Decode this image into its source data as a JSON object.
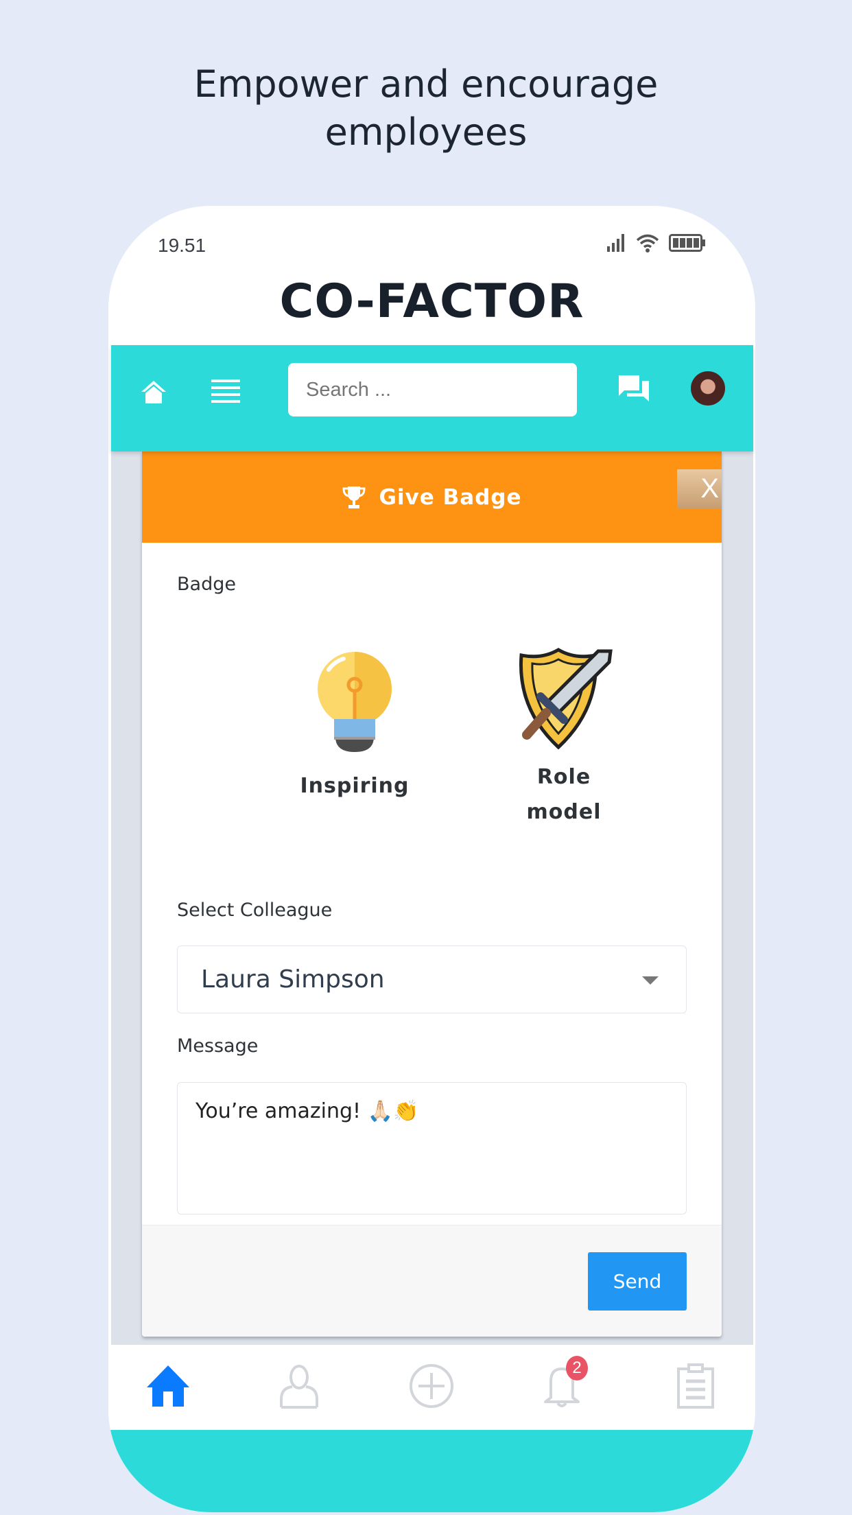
{
  "headline": {
    "line1": "Empower and encourage",
    "line2": "employees"
  },
  "status_bar": {
    "time": "19.51",
    "icons": [
      "signal-icon",
      "wifi-icon",
      "battery-icon"
    ]
  },
  "app": {
    "brand": "CO-FACTOR",
    "accent": "#2cdada",
    "header_color": "#fd9213",
    "primary": "#2196f3"
  },
  "topbar": {
    "search_placeholder": "Search ...",
    "icons": [
      "home-icon",
      "menu-icon",
      "chat-icon",
      "avatar"
    ]
  },
  "modal": {
    "title": "Give Badge",
    "close": "X",
    "badge_label": "Badge",
    "badges": [
      {
        "name": "Inspiring",
        "icon": "lightbulb-icon"
      },
      {
        "name": "Role\nmodel",
        "line1": "Role",
        "line2": "model",
        "icon": "shield-sword-icon"
      }
    ],
    "colleague_label": "Select Colleague",
    "colleague_value": "Laura Simpson",
    "message_label": "Message",
    "message_value": "You’re amazing! 🙏🏻👏",
    "send": "Send"
  },
  "bottom_nav": {
    "items": [
      "home",
      "profile",
      "add",
      "notifications",
      "tasks"
    ],
    "notification_count": "2",
    "active": "home",
    "active_color": "#0a7bff"
  }
}
